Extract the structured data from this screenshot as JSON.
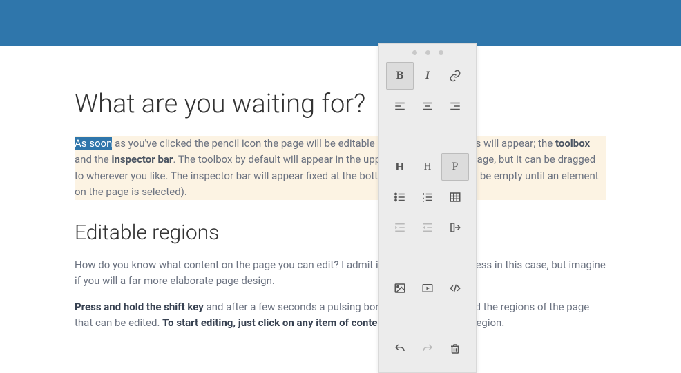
{
  "heading1": "What are you waiting for?",
  "para1": {
    "selected": "As soon",
    "t1": " as you've clicked the pencil icon the page will be editable and two new elements will appear; the ",
    "b1": "toolbox",
    "t2": " and the ",
    "b2": "inspector bar",
    "t3": ". The toolbox by default will appear in the upper left corner of the page, but it can be dragged to wherever you like. The inspector bar will appear fixed at the bottom of the page (it will be empty until an element on the page is selected)."
  },
  "heading2": "Editable regions",
  "para2": "How do you know what content on the page you can edit? I admit it's not that hard to guess in this case, but imagine if you will a far more elaborate page design.",
  "para3": {
    "b1": "Press and hold the shift key",
    "t1": " and after a few seconds a pulsing border will appear around the regions of the page that can be edited. ",
    "b2": "To start editing, just click on any item of content",
    "t2": " within an editable region."
  },
  "toolbox": {
    "bold": "B",
    "italic": "I",
    "h1": "H",
    "h2": "H",
    "p": "P"
  }
}
